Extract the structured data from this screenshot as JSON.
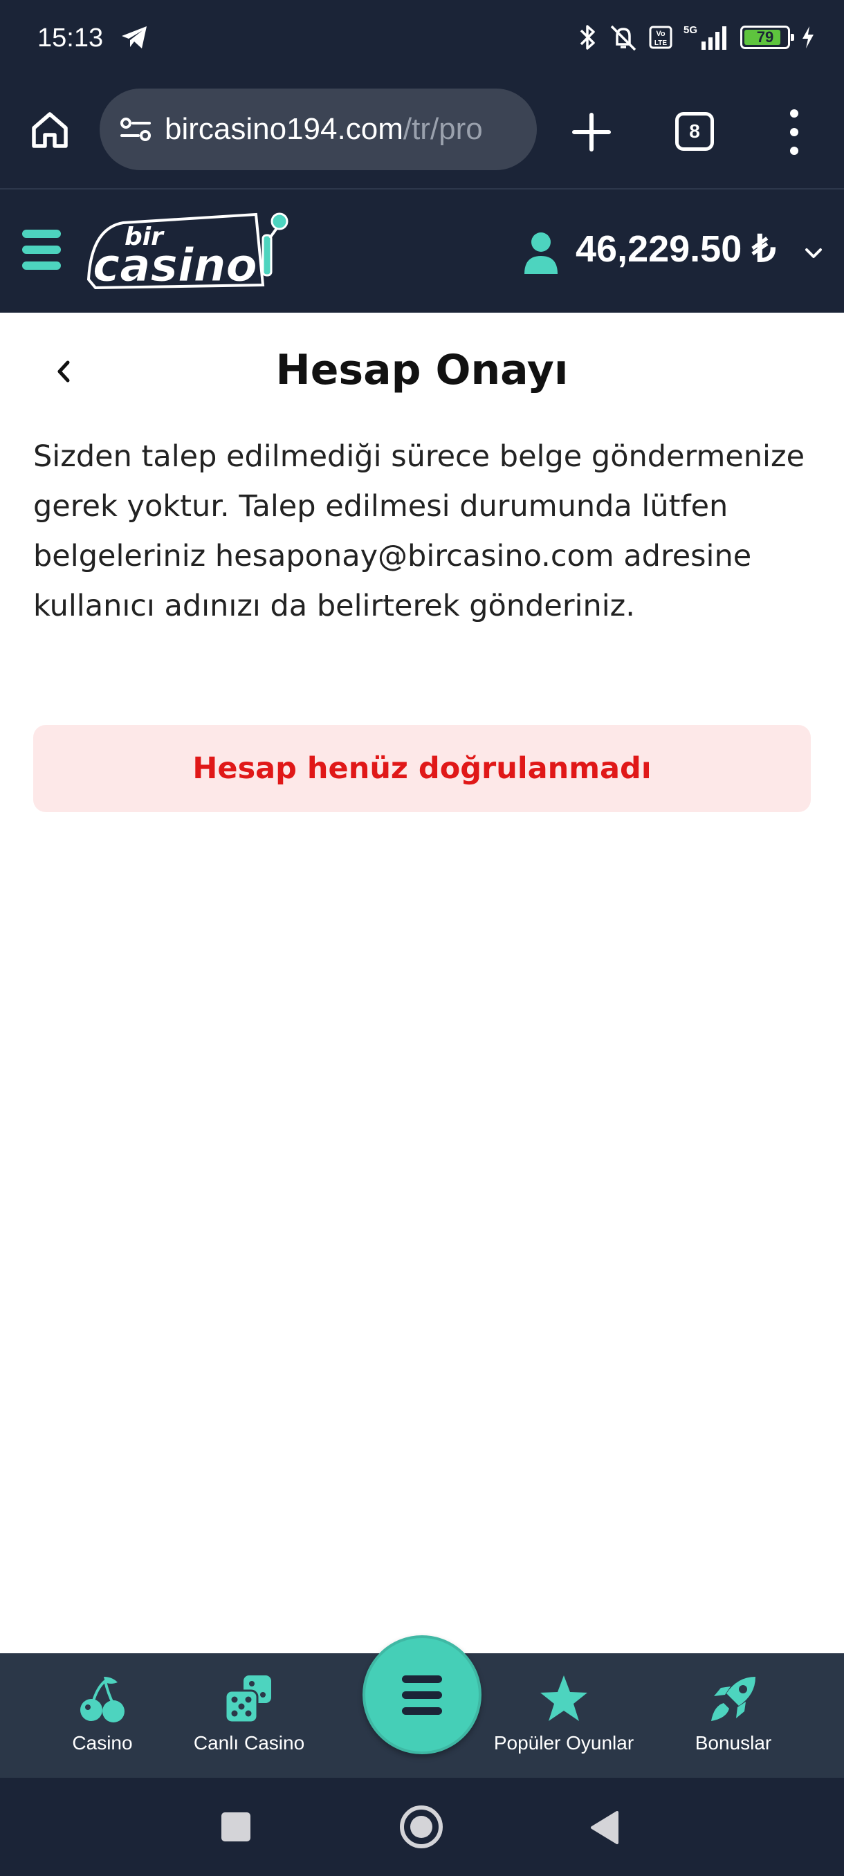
{
  "status_bar": {
    "time": "15:13",
    "battery": "79",
    "network": "5G",
    "volte": "Vo LTE"
  },
  "browser": {
    "url_host": "bircasino194.com",
    "url_path": "/tr/pro",
    "tab_count": "8"
  },
  "site_header": {
    "logo_top": "bir",
    "logo_main": "casino",
    "balance": "46,229.50 ₺"
  },
  "page": {
    "title": "Hesap Onayı",
    "info_text": "Sizden talep edilmediği sürece belge göndermenize gerek yoktur. Talep edilmesi durumunda lütfen belgeleriniz hesaponay@bircasino.com adresine kullanıcı adınızı da belirterek gönderiniz.",
    "status_alert": "Hesap henüz doğrulanmadı"
  },
  "bottom_nav": {
    "items": [
      {
        "label": "Casino",
        "icon": "cherry-icon"
      },
      {
        "label": "Canlı Casino",
        "icon": "dice-icon"
      },
      {
        "label": "Popüler Oyunlar",
        "icon": "star-icon"
      },
      {
        "label": "Bonuslar",
        "icon": "rocket-icon"
      }
    ]
  },
  "colors": {
    "header_bg": "#1b2437",
    "accent": "#45cfb7",
    "alert_bg": "#fde8e8",
    "alert_text": "#e01818",
    "nav_bg": "#2b3748"
  }
}
